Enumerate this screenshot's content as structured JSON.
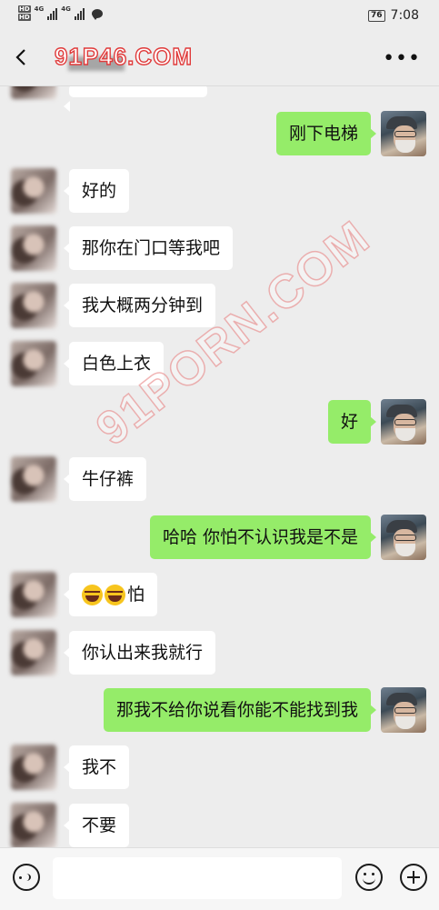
{
  "status_bar": {
    "hd1": "HD",
    "hd2": "HD",
    "net1": "4G",
    "net2": "4G",
    "battery": "76",
    "time": "7:08"
  },
  "header": {
    "watermark": "91P46.COM",
    "more_icon": "more-dots-icon",
    "back_icon": "chevron-left-icon"
  },
  "watermark_diagonal": "91PORN.COM",
  "messages": [
    {
      "side": "in",
      "text": ""
    },
    {
      "side": "out",
      "text": "刚下电梯"
    },
    {
      "side": "in",
      "text": "好的"
    },
    {
      "side": "in",
      "text": "那你在门口等我吧"
    },
    {
      "side": "in",
      "text": "我大概两分钟到"
    },
    {
      "side": "in",
      "text": "白色上衣"
    },
    {
      "side": "out",
      "text": "好"
    },
    {
      "side": "in",
      "text": "牛仔裤"
    },
    {
      "side": "out",
      "text": "哈哈 你怕不认识我是不是"
    },
    {
      "side": "in",
      "text": "怕",
      "emoji": "tears-of-joy-emoji x2"
    },
    {
      "side": "in",
      "text": "你认出来我就行"
    },
    {
      "side": "out",
      "text": "那我不给你说看你能不能找到我"
    },
    {
      "side": "in",
      "text": "我不"
    },
    {
      "side": "in",
      "text": "不要"
    }
  ],
  "input_bar": {
    "placeholder": "",
    "voice_icon": "voice-icon",
    "emoji_icon": "smiley-icon",
    "plus_icon": "plus-icon"
  },
  "colors": {
    "background": "#ededed",
    "outgoing_bubble": "#95ec69",
    "incoming_bubble": "#ffffff"
  }
}
